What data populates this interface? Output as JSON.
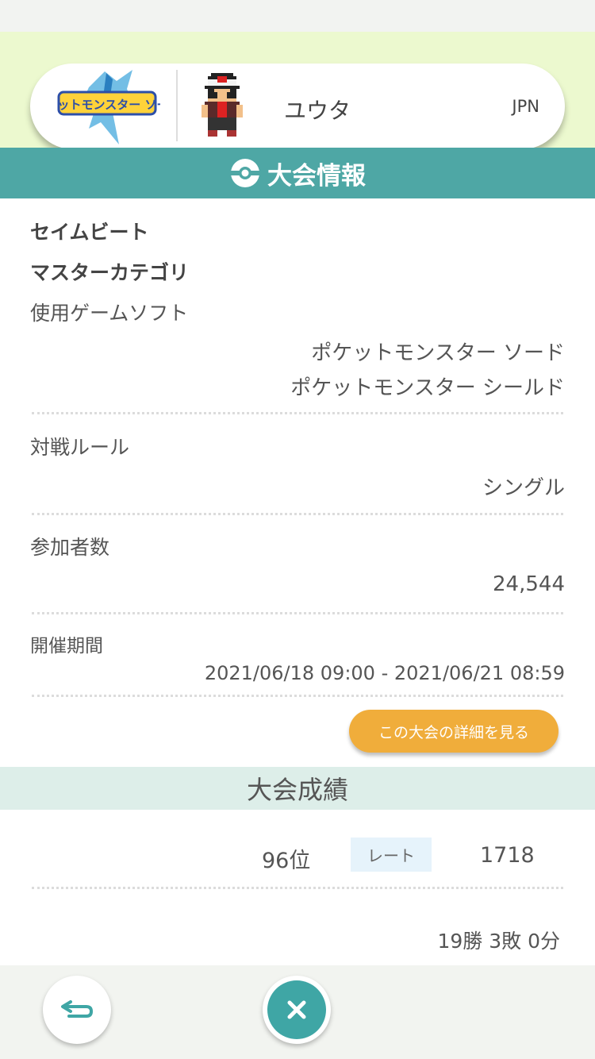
{
  "profile": {
    "game_logo_text": "ポケットモンスター ソード",
    "player_name": "ユウタ",
    "country": "JPN"
  },
  "tournament_info": {
    "header": "大会情報",
    "name": "セイムビート",
    "category": "マスターカテゴリ",
    "software_label": "使用ゲームソフト",
    "software_values": [
      "ポケットモンスター ソード",
      "ポケットモンスター シールド"
    ],
    "rule_label": "対戦ルール",
    "rule_value": "シングル",
    "participants_label": "参加者数",
    "participants_value": "24,544",
    "period_label": "開催期間",
    "period_value": "2021/06/18 09:00 - 2021/06/21 08:59",
    "detail_button": "この大会の詳細を見る"
  },
  "results": {
    "header": "大会成績",
    "rank": "96位",
    "rate_label": "レート",
    "rate_value": "1718",
    "record": "19勝 3敗 0分"
  },
  "colors": {
    "teal": "#4ea7a5",
    "orange": "#f0ad3b",
    "profile_bg": "#ecf9cf"
  },
  "icons": {
    "ball": "poke-ball-icon",
    "back": "back-arrow-icon",
    "close": "close-icon"
  }
}
